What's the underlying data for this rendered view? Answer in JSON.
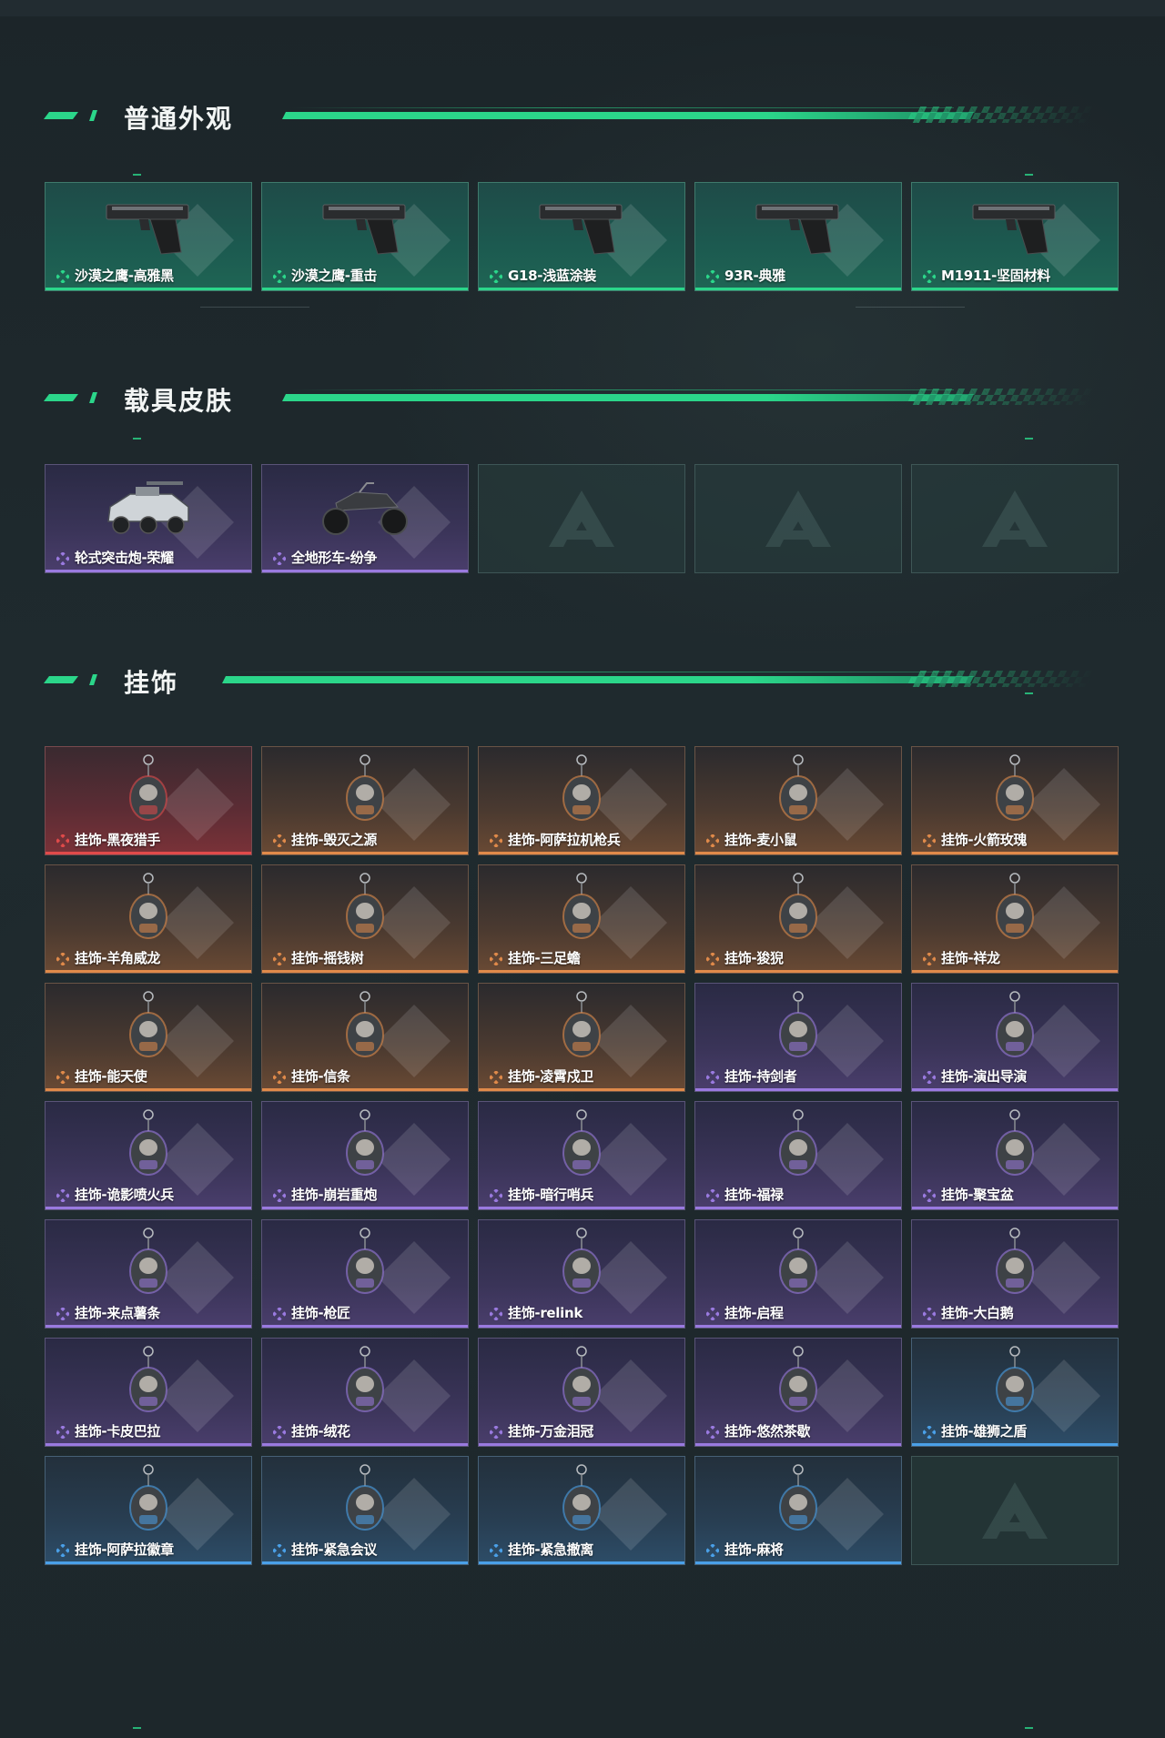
{
  "sections": [
    {
      "title": "普通外观",
      "items": [
        {
          "label": "沙漠之鹰-高雅黑",
          "rarity": "green",
          "icon": "pistol-icon"
        },
        {
          "label": "沙漠之鹰-重击",
          "rarity": "green",
          "icon": "pistol-icon"
        },
        {
          "label": "G18-浅蓝涂装",
          "rarity": "green",
          "icon": "pistol-icon"
        },
        {
          "label": "93R-典雅",
          "rarity": "green",
          "icon": "pistol-icon"
        },
        {
          "label": "M1911-坚固材料",
          "rarity": "green",
          "icon": "pistol-icon"
        }
      ]
    },
    {
      "title": "载具皮肤",
      "items": [
        {
          "label": "轮式突击炮-荣耀",
          "rarity": "purple",
          "icon": "vehicle-icon"
        },
        {
          "label": "全地形车-纷争",
          "rarity": "purple",
          "icon": "atv-icon"
        },
        {
          "label": "",
          "rarity": "empty"
        },
        {
          "label": "",
          "rarity": "empty"
        },
        {
          "label": "",
          "rarity": "empty"
        }
      ]
    },
    {
      "title": "挂饰",
      "items": [
        {
          "label": "挂饰-黑夜猎手",
          "rarity": "red",
          "icon": "charm-icon"
        },
        {
          "label": "挂饰-毁灭之源",
          "rarity": "orange",
          "icon": "charm-icon"
        },
        {
          "label": "挂饰-阿萨拉机枪兵",
          "rarity": "orange",
          "icon": "charm-icon"
        },
        {
          "label": "挂饰-麦小鼠",
          "rarity": "orange",
          "icon": "charm-icon"
        },
        {
          "label": "挂饰-火箭玫瑰",
          "rarity": "orange",
          "icon": "charm-icon"
        },
        {
          "label": "挂饰-羊角威龙",
          "rarity": "orange",
          "icon": "charm-icon"
        },
        {
          "label": "挂饰-摇钱树",
          "rarity": "orange",
          "icon": "charm-icon"
        },
        {
          "label": "挂饰-三足蟾",
          "rarity": "orange",
          "icon": "charm-icon"
        },
        {
          "label": "挂饰-狻猊",
          "rarity": "orange",
          "icon": "charm-icon"
        },
        {
          "label": "挂饰-祥龙",
          "rarity": "orange",
          "icon": "charm-icon"
        },
        {
          "label": "挂饰-能天使",
          "rarity": "orange",
          "icon": "charm-icon"
        },
        {
          "label": "挂饰-信条",
          "rarity": "orange",
          "icon": "charm-icon"
        },
        {
          "label": "挂饰-凌霄戍卫",
          "rarity": "orange",
          "icon": "charm-icon"
        },
        {
          "label": "挂饰-持剑者",
          "rarity": "purple",
          "icon": "charm-icon"
        },
        {
          "label": "挂饰-演出导演",
          "rarity": "purple",
          "icon": "charm-icon"
        },
        {
          "label": "挂饰-诡影喷火兵",
          "rarity": "purple",
          "icon": "charm-icon"
        },
        {
          "label": "挂饰-崩岩重炮",
          "rarity": "purple",
          "icon": "charm-icon"
        },
        {
          "label": "挂饰-暗行哨兵",
          "rarity": "purple",
          "icon": "charm-icon"
        },
        {
          "label": "挂饰-福禄",
          "rarity": "purple",
          "icon": "charm-icon"
        },
        {
          "label": "挂饰-聚宝盆",
          "rarity": "purple",
          "icon": "charm-icon"
        },
        {
          "label": "挂饰-来点薯条",
          "rarity": "purple",
          "icon": "charm-icon"
        },
        {
          "label": "挂饰-枪匠",
          "rarity": "purple",
          "icon": "charm-icon"
        },
        {
          "label": "挂饰-relink",
          "rarity": "purple",
          "icon": "charm-icon"
        },
        {
          "label": "挂饰-启程",
          "rarity": "purple",
          "icon": "charm-icon"
        },
        {
          "label": "挂饰-大白鹅",
          "rarity": "purple",
          "icon": "charm-icon"
        },
        {
          "label": "挂饰-卡皮巴拉",
          "rarity": "purple",
          "icon": "charm-icon"
        },
        {
          "label": "挂饰-绒花",
          "rarity": "purple",
          "icon": "charm-icon"
        },
        {
          "label": "挂饰-万金泪冠",
          "rarity": "purple",
          "icon": "charm-icon"
        },
        {
          "label": "挂饰-悠然茶歇",
          "rarity": "purple",
          "icon": "charm-icon"
        },
        {
          "label": "挂饰-雄狮之盾",
          "rarity": "blue",
          "icon": "charm-icon"
        },
        {
          "label": "挂饰-阿萨拉徽章",
          "rarity": "blue",
          "icon": "charm-icon"
        },
        {
          "label": "挂饰-紧急会议",
          "rarity": "blue",
          "icon": "charm-icon"
        },
        {
          "label": "挂饰-紧急撤离",
          "rarity": "blue",
          "icon": "charm-icon"
        },
        {
          "label": "挂饰-麻将",
          "rarity": "blue",
          "icon": "charm-icon"
        },
        {
          "label": "",
          "rarity": "empty"
        }
      ]
    }
  ],
  "colors": {
    "accent": "#2bd68a",
    "green": "#2bd68a",
    "purple": "#9a7ae0",
    "orange": "#e08a4a",
    "red": "#e04a4a",
    "blue": "#4aa0e8"
  }
}
